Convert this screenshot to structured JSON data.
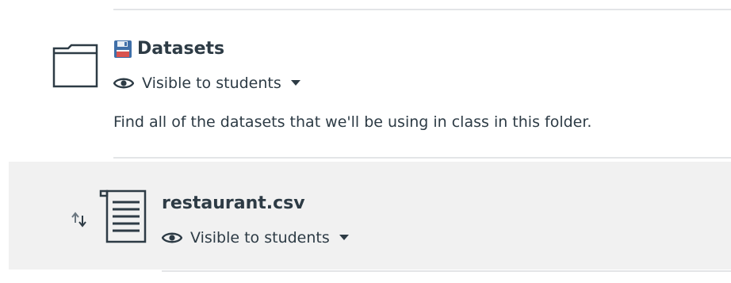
{
  "folder": {
    "title": "Datasets",
    "visibility": "Visible to students",
    "description": "Find all of the datasets that we'll be using in class in this folder."
  },
  "file": {
    "title": "restaurant.csv",
    "visibility": "Visible to students"
  },
  "icons": {
    "folder": "folder-icon",
    "floppy": "floppy-disk-icon",
    "eye": "eye-icon",
    "caret": "caret-down-icon",
    "sort": "sort-arrows-icon",
    "file": "document-icon"
  },
  "colors": {
    "text": "#2d3b45",
    "row_bg": "#f1f1f1",
    "divider": "#e3e5e7",
    "floppy_blue": "#3f6fa8"
  }
}
